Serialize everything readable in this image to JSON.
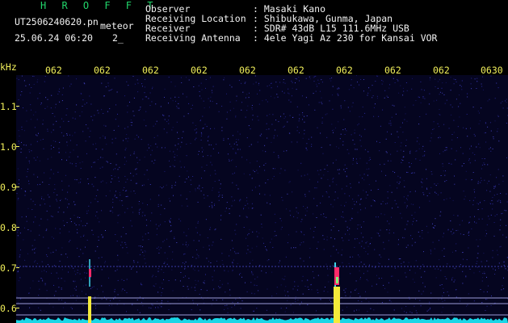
{
  "app": {
    "name": "H R O F F T",
    "filename": "UT2506240620.pn",
    "mode": "meteor",
    "datetime": "25.06.24 06:20",
    "index": "2_"
  },
  "info": {
    "rows": [
      {
        "label": "Observer",
        "value": ": Masaki Kano"
      },
      {
        "label": "Receiving Location",
        "value": ": Shibukawa, Gunma, Japan"
      },
      {
        "label": "Receiver",
        "value": ": SDR# 43dB L15 111.6MHz USB"
      },
      {
        "label": "Receiving Antenna",
        "value": ": 4ele Yagi Az 230 for Kansai VOR"
      }
    ]
  },
  "axes": {
    "y_unit": "kHz",
    "x_ticks": [
      "062",
      "062",
      "062",
      "062",
      "062",
      "062",
      "062",
      "062",
      "062",
      "0630"
    ],
    "y_ticks": [
      "1.1",
      "1.0",
      "0.9",
      "0.8",
      "0.7",
      "0.6"
    ]
  },
  "colors": {
    "background": "#000000",
    "plot_bg": "#050520",
    "label_yellow": "#f1ef5b",
    "title_green": "#21d66b",
    "baseline_cyan": "#19d6e6",
    "meteor_red": "#ff2a6a"
  }
}
